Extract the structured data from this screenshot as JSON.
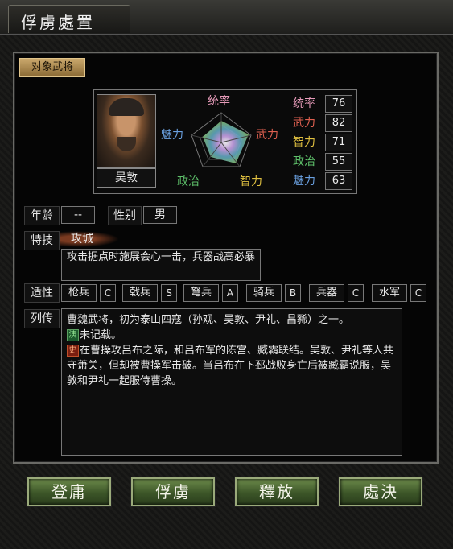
{
  "window": {
    "title": "俘虜處置"
  },
  "section_tag": "对象武将",
  "officer": {
    "name": "吴敦",
    "radar_labels": {
      "top": "统率",
      "right": "武力",
      "bottom_right": "智力",
      "bottom_left": "政治",
      "left": "魅力"
    },
    "stats": [
      {
        "name": "统率",
        "value": "76",
        "color": "#e59ab8"
      },
      {
        "name": "武力",
        "value": "82",
        "color": "#e06050"
      },
      {
        "name": "智力",
        "value": "71",
        "color": "#e0c040"
      },
      {
        "name": "政治",
        "value": "55",
        "color": "#5ec06a"
      },
      {
        "name": "魅力",
        "value": "63",
        "color": "#6aa0e0"
      }
    ],
    "age_label": "年龄",
    "age_value": "--",
    "gender_label": "性别",
    "gender_value": "男",
    "skill_label": "特技",
    "skill_name": "攻城",
    "skill_desc": "攻击据点时施展会心一击，兵器战高必暴",
    "aptitude_label": "适性",
    "aptitudes": [
      {
        "name": "枪兵",
        "grade": "C"
      },
      {
        "name": "戟兵",
        "grade": "S"
      },
      {
        "name": "弩兵",
        "grade": "A"
      },
      {
        "name": "骑兵",
        "grade": "B"
      },
      {
        "name": "兵器",
        "grade": "C"
      },
      {
        "name": "水军",
        "grade": "C"
      }
    ],
    "bio_label": "列传",
    "bio_line1": "曹魏武将，初为泰山四寇（孙观、吴敦、尹礼、昌豨）之一。",
    "bio_badge2": "演",
    "bio_line2": "未记载。",
    "bio_badge3": "史",
    "bio_line3": "在曹操攻吕布之际，和吕布军的陈宫、臧霸联结。吴敦、尹礼等人共守萧关，但却被曹操军击破。当吕布在下邳战败身亡后被臧霸说服，吴敦和尹礼一起服侍曹操。"
  },
  "buttons": {
    "recruit": "登庸",
    "capture": "俘虜",
    "release": "釋放",
    "execute": "處決"
  }
}
